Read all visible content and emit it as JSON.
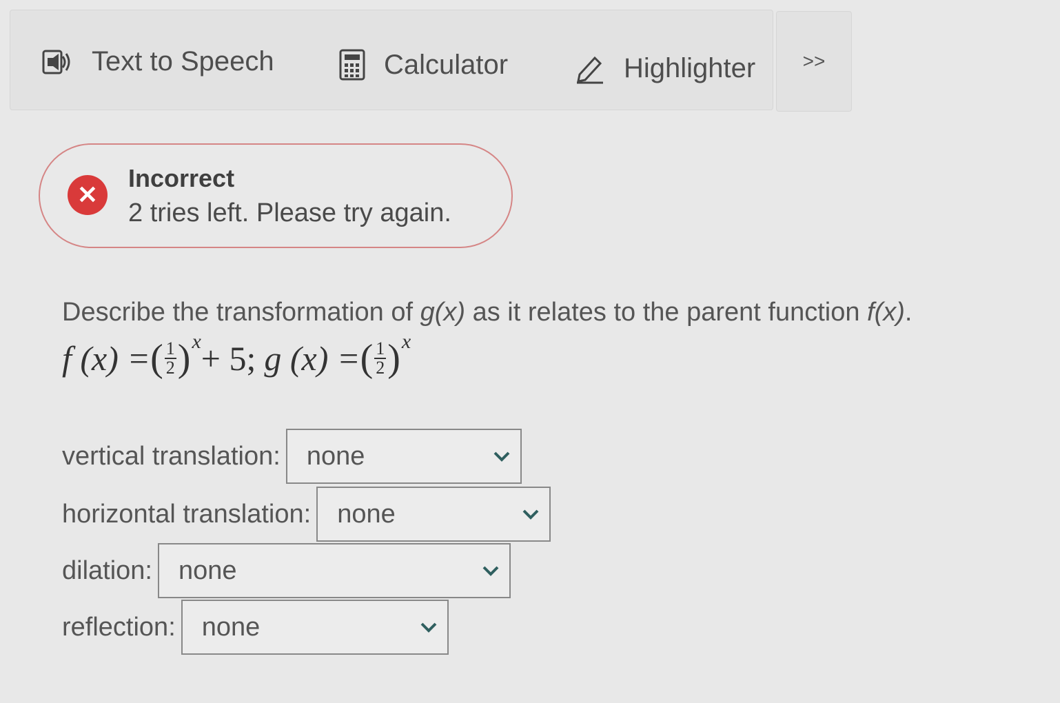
{
  "toolbar": {
    "text_to_speech": "Text to Speech",
    "calculator": "Calculator",
    "highlighter": "Highlighter",
    "more": ">>"
  },
  "feedback": {
    "title": "Incorrect",
    "message": "2 tries left. Please try again.",
    "icon": "close-icon",
    "color": "#d93a3a"
  },
  "question": {
    "prefix": "Describe the transformation of ",
    "g": "g(x)",
    "middle": " as it relates to the parent function ",
    "f": "f(x)",
    "suffix": "."
  },
  "formula": {
    "f_lhs": "f (x) = ",
    "num": "1",
    "den": "2",
    "exp": "x",
    "f_tail": " + 5;",
    "g_lhs": " g (x) = "
  },
  "fields": [
    {
      "label": "vertical translation:",
      "value": "none"
    },
    {
      "label": "horizontal translation:",
      "value": "none"
    },
    {
      "label": "dilation:",
      "value": "none"
    },
    {
      "label": "reflection:",
      "value": "none"
    }
  ]
}
